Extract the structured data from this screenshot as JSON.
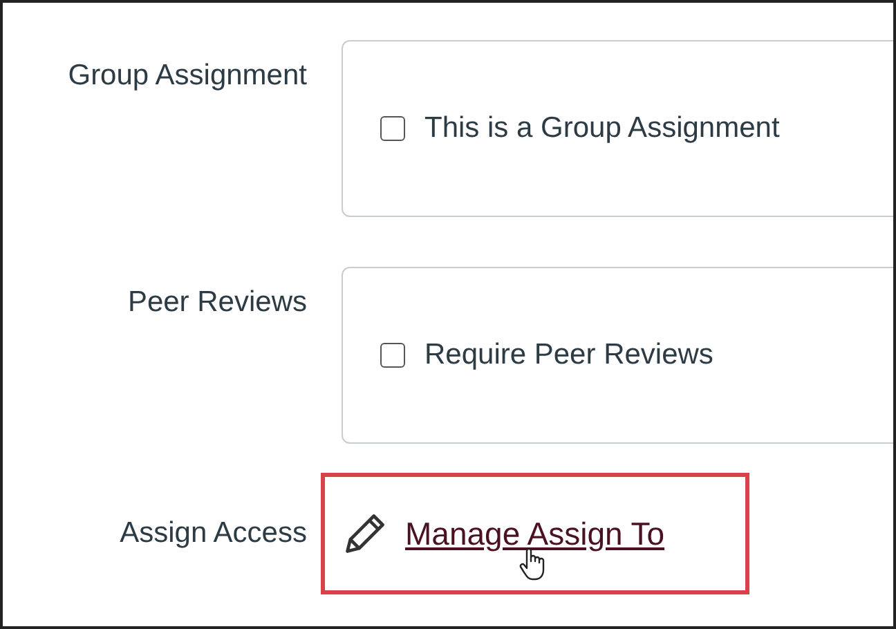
{
  "settings": [
    {
      "label": "Group Assignment",
      "checkbox": {
        "label": "This is a Group Assignment",
        "checked": false
      }
    },
    {
      "label": "Peer Reviews",
      "checkbox": {
        "label": "Require Peer Reviews",
        "checked": false
      }
    }
  ],
  "assign_access": {
    "label": "Assign Access",
    "link": "Manage Assign To",
    "highlighted": true
  }
}
